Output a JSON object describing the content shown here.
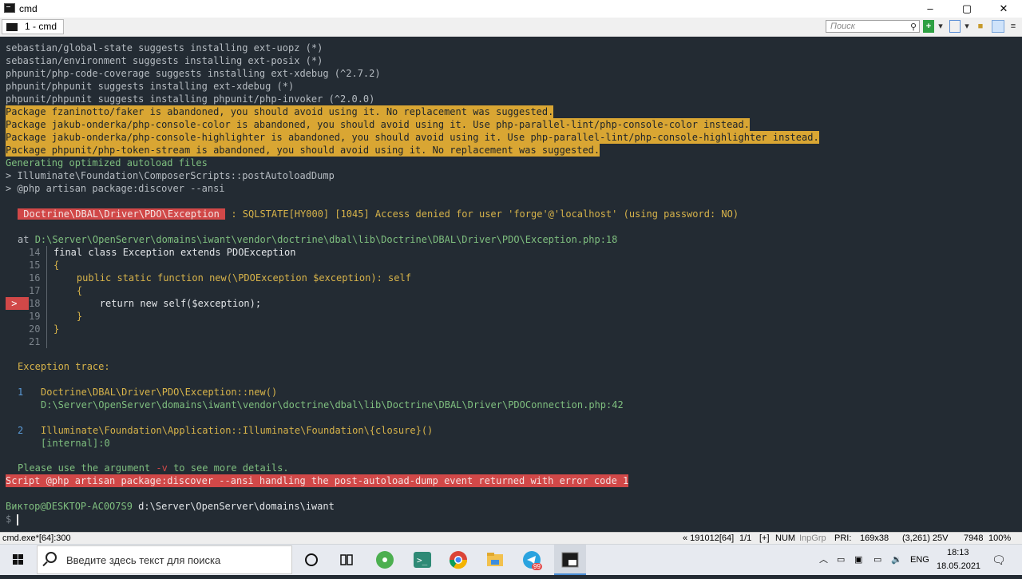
{
  "window": {
    "title": "cmd",
    "minimize": "–",
    "maximize": "▢",
    "close": "✕"
  },
  "tab": {
    "label": "1 - cmd"
  },
  "search": {
    "placeholder": "Поиск"
  },
  "terminal": {
    "lines": [
      {
        "text": "sebastian/global-state suggests installing ext-uopz (*)",
        "style": ""
      },
      {
        "text": "sebastian/environment suggests installing ext-posix (*)",
        "style": ""
      },
      {
        "text": "phpunit/php-code-coverage suggests installing ext-xdebug (^2.7.2)",
        "style": ""
      },
      {
        "text": "phpunit/phpunit suggests installing ext-xdebug (*)",
        "style": ""
      },
      {
        "text": "phpunit/phpunit suggests installing phpunit/php-invoker (^2.0.0)",
        "style": ""
      },
      {
        "text": "Package fzaninotto/faker is abandoned, you should avoid using it. No replacement was suggested.",
        "style": "hl"
      },
      {
        "text": "Package jakub-onderka/php-console-color is abandoned, you should avoid using it. Use php-parallel-lint/php-console-color instead.",
        "style": "hl"
      },
      {
        "text": "Package jakub-onderka/php-console-highlighter is abandoned, you should avoid using it. Use php-parallel-lint/php-console-highlighter instead.",
        "style": "hl"
      },
      {
        "text": "Package phpunit/php-token-stream is abandoned, you should avoid using it. No replacement was suggested.",
        "style": "hl"
      },
      {
        "text": "Generating optimized autoload files",
        "style": "green"
      },
      {
        "text": "> Illuminate\\Foundation\\ComposerScripts::postAutoloadDump",
        "style": ""
      },
      {
        "text": "> @php artisan package:discover --ansi",
        "style": ""
      }
    ],
    "exception_class": " Doctrine\\DBAL\\Driver\\PDO\\Exception ",
    "exception_message": " : SQLSTATE[HY000] [1045] Access denied for user 'forge'@'localhost' (using password: NO)",
    "at_prefix": "at ",
    "at_path": "D:\\Server\\OpenServer\\domains\\iwant\\vendor\\doctrine\\dbal\\lib\\Doctrine\\DBAL\\Driver\\PDO\\Exception.php:18",
    "code": [
      {
        "num": "14",
        "text": "final class Exception extends PDOException"
      },
      {
        "num": "15",
        "text": "{"
      },
      {
        "num": "16",
        "text": "    public static function new(\\PDOException $exception): self"
      },
      {
        "num": "17",
        "text": "    {"
      },
      {
        "num": "18",
        "text": "        return new self($exception);"
      },
      {
        "num": "19",
        "text": "    }"
      },
      {
        "num": "20",
        "text": "}"
      },
      {
        "num": "21",
        "text": ""
      }
    ],
    "current_line_marker": " > ",
    "trace_title": "Exception trace:",
    "trace": [
      {
        "num": "1",
        "call": "Doctrine\\DBAL\\Driver\\PDO\\Exception::new()",
        "file": "D:\\Server\\OpenServer\\domains\\iwant\\vendor\\doctrine\\dbal\\lib\\Doctrine\\DBAL\\Driver\\PDOConnection.php:42"
      },
      {
        "num": "2",
        "call": "Illuminate\\Foundation\\Application::Illuminate\\Foundation\\{closure}()",
        "file": "[internal]:0"
      }
    ],
    "hint_a": "Please use the argument ",
    "hint_flag": "-v",
    "hint_b": " to see more details.",
    "error_line": "Script @php artisan package:discover --ansi handling the post-autoload-dump event returned with error code 1",
    "prompt_user": "Виктор@DESKTOP-AC0O7S9",
    "prompt_path": " d:\\Server\\OpenServer\\domains\\iwant",
    "prompt_symbol": "$ "
  },
  "statusbar": {
    "left": "cmd.exe*[64]:300",
    "items": [
      "« 191012[64]",
      "1/1",
      "[+]",
      "NUM",
      "InpGrp",
      "PRI:",
      "169x38",
      "(3,261) 25V",
      "7948",
      "100%"
    ]
  },
  "taskbar": {
    "search_placeholder": "Введите здесь текст для поиска",
    "language": "ENG",
    "time": "18:13",
    "date": "18.05.2021",
    "telegram_badge": "99"
  }
}
